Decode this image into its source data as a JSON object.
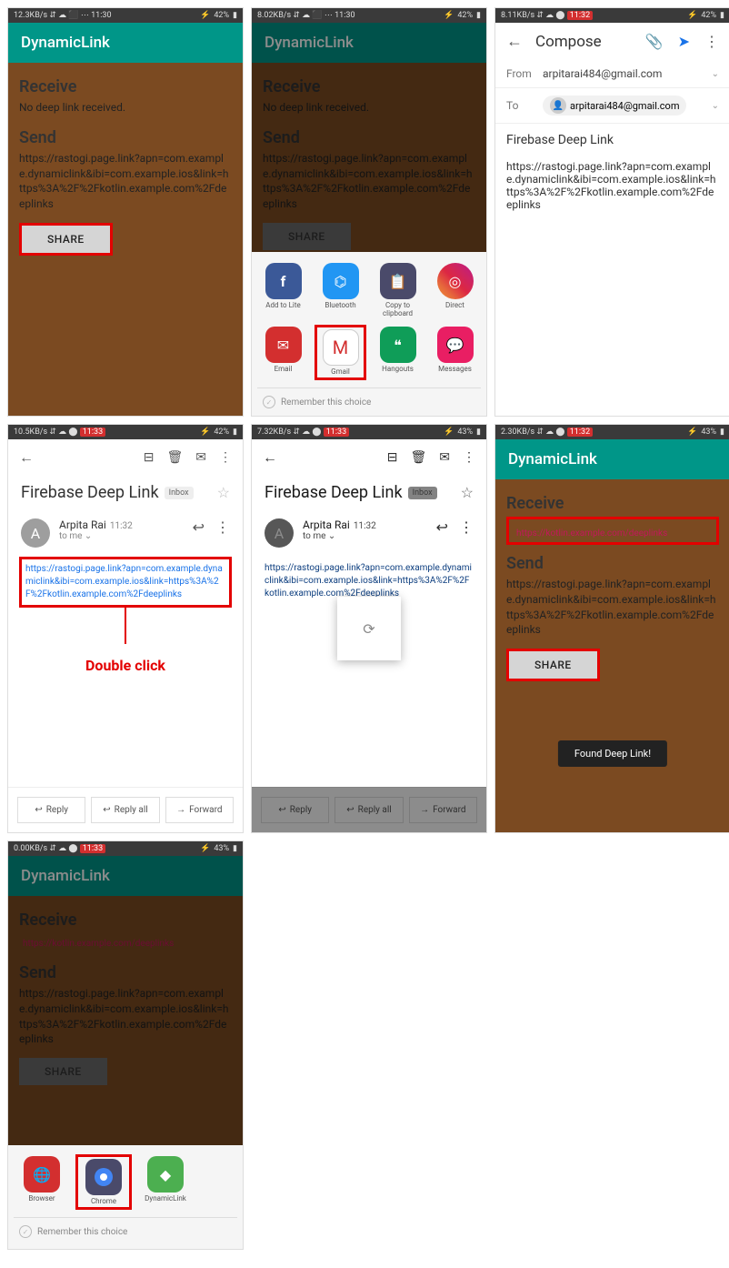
{
  "status": {
    "s1": "12.3KB/s",
    "s2": "8.02KB/s",
    "s3": "8.11KB/s",
    "s4": "10.5KB/s",
    "s5": "7.32KB/s",
    "s6": "2.30KB/s",
    "s7": "0.00KB/s",
    "t1": "11:30",
    "t2": "11:30",
    "t3": "11:32",
    "t4": "11:33",
    "t5": "11:33",
    "t6": "11:32",
    "t7": "11:33",
    "b1": "42%",
    "b2": "42%",
    "b3": "42%",
    "b4": "42%",
    "b5": "43%",
    "b6": "43%",
    "b7": "43%"
  },
  "app": {
    "title": "DynamicLink"
  },
  "dl": {
    "receive_label": "Receive",
    "no_link": "No deep link received.",
    "send_label": "Send",
    "send_url": "https://rastogi.page.link?apn=com.example.dynamiclink&ibi=com.example.ios&link=https%3A%2F%2Fkotlin.example.com%2Fdeeplinks",
    "share_btn": "SHARE",
    "received_url": "https://kotlin.example.com/deeplinks",
    "toast": "Found Deep Link!"
  },
  "share": {
    "items_row1": [
      {
        "label": "Add to Lite"
      },
      {
        "label": "Bluetooth"
      },
      {
        "label": "Copy to clipboard"
      },
      {
        "label": "Direct"
      }
    ],
    "items_row2": [
      {
        "label": "Email"
      },
      {
        "label": "Gmail"
      },
      {
        "label": "Hangouts"
      },
      {
        "label": "Messages"
      }
    ],
    "remember": "Remember this choice"
  },
  "compose": {
    "title": "Compose",
    "from_label": "From",
    "from_value": "arpitarai484@gmail.com",
    "to_label": "To",
    "to_value": "arpitarai484@gmail.com",
    "subject": "Firebase Deep Link",
    "body": "https://rastogi.page.link?apn=com.example.dynamiclink&ibi=com.example.ios&link=https%3A%2F%2Fkotlin.example.com%2Fdeeplinks"
  },
  "email": {
    "subject": "Firebase Deep Link",
    "chip": "Inbox",
    "sender": "Arpita Rai",
    "time": "11:32",
    "to": "to me",
    "link": "https://rastogi.page.link?apn=com.example.dynamiclink&ibi=com.example.ios&link=https%3A%2F%2Fkotlin.example.com%2Fdeeplinks",
    "reply": "Reply",
    "reply_all": "Reply all",
    "forward": "Forward"
  },
  "annotation": {
    "text": "Double click"
  },
  "open": {
    "items": [
      {
        "label": "Browser"
      },
      {
        "label": "Chrome"
      },
      {
        "label": "DynamicLink"
      }
    ],
    "remember": "Remember this choice"
  }
}
